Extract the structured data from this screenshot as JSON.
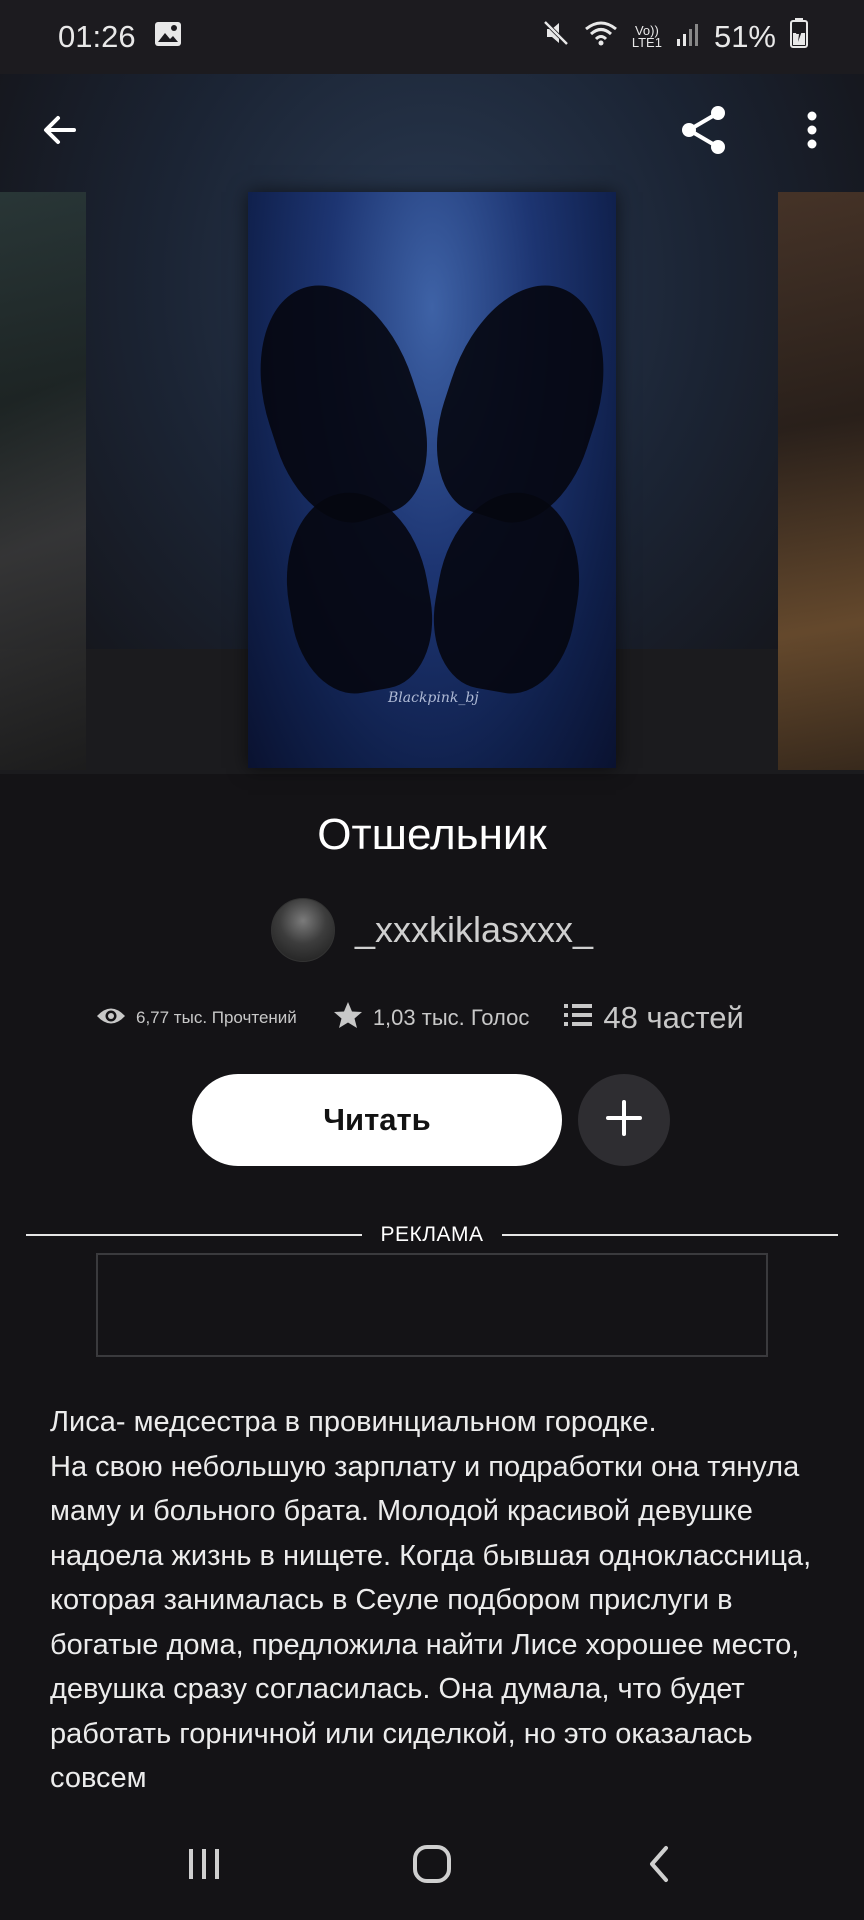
{
  "status_bar": {
    "time": "01:26",
    "battery": "51%",
    "network_label_top": "Vo))",
    "network_label_bottom": "LTE1",
    "icons": [
      "image-icon",
      "mute-icon",
      "wifi-icon",
      "signal-icon",
      "battery-icon"
    ]
  },
  "header": {
    "back_icon": "arrow-left-icon",
    "share_icon": "share-icon",
    "more_icon": "more-vertical-icon",
    "cover_signature": "Blackpink_bj"
  },
  "story": {
    "title": "Отшельник",
    "author": "_xxxkiklasxxx_",
    "stats": {
      "views": "6,77 тыс. Прочтений",
      "votes": "1,03 тыс. Голос",
      "parts": "48 частей"
    },
    "read_button": "Читать",
    "add_icon": "plus-icon"
  },
  "ad": {
    "label": "РЕКЛАМА"
  },
  "description": "Лиса- медсестра в провинциальном городке.\nНа свою небольшую зарплату и подработки она тянула маму и больного брата. Молодой красивой девушке надоела жизнь в нищете. Когда бывшая одноклассница, которая занималась в Сеуле подбором прислуги в богатые дома, предложила найти Лисе хорошее место, девушка сразу согласилась. Она думала, что будет работать горничной или сиделкой, но это оказалась совсем",
  "nav_bar": {
    "icons": [
      "recent-apps-icon",
      "home-icon",
      "back-nav-icon"
    ]
  }
}
